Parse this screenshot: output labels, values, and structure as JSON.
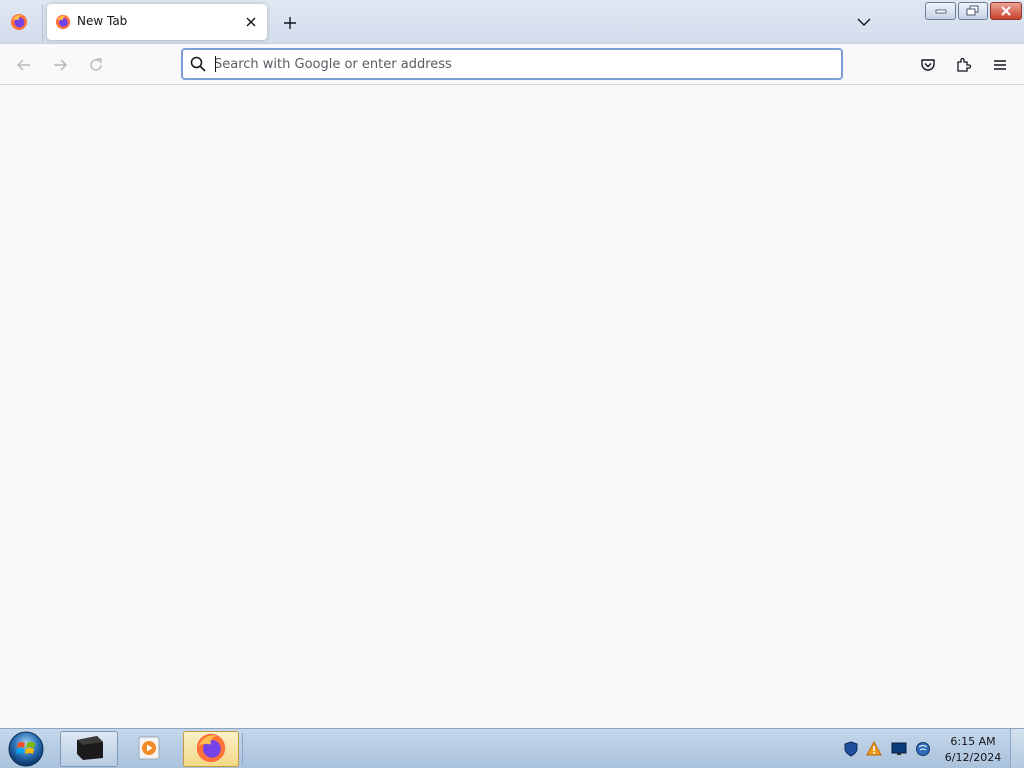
{
  "browser": {
    "tab": {
      "title": "New Tab"
    },
    "urlbar": {
      "placeholder": "Search with Google or enter address",
      "value": ""
    }
  },
  "icons": {
    "app_menu": "firefox-logo-icon",
    "tab_favicon": "firefox-logo-icon",
    "tab_close": "close-icon",
    "new_tab": "plus-icon",
    "list_tabs": "chevron-down-icon",
    "back": "arrow-left-icon",
    "forward": "arrow-right-icon",
    "reload": "reload-icon",
    "url_search": "search-icon",
    "pocket": "pocket-icon",
    "extensions": "puzzle-piece-icon",
    "menu": "hamburger-menu-icon"
  },
  "taskbar": {
    "apps": [
      "command-prompt",
      "media-player",
      "firefox"
    ],
    "tray": [
      "security-shield-icon",
      "vlc-alert-icon",
      "display-icon",
      "network-icon"
    ],
    "clock": {
      "time": "6:15 AM",
      "date": "6/12/2024"
    }
  },
  "colors": {
    "accent_focus": "#7aa0d8",
    "content_bg": "#f9f9fb",
    "tabstrip_bg": "#d3dded"
  }
}
